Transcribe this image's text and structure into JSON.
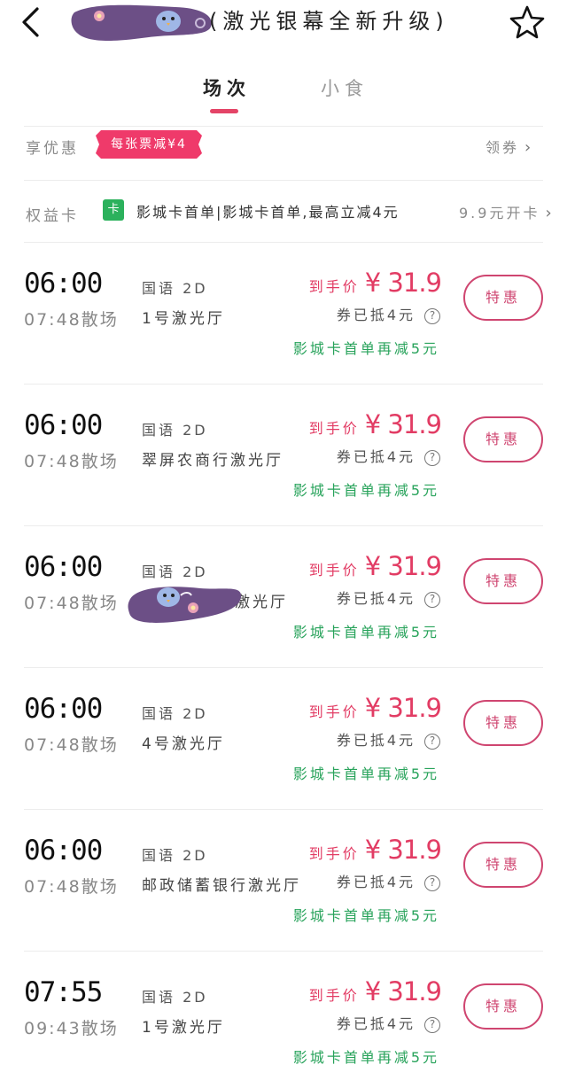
{
  "header": {
    "title": "(激光银幕全新升级)",
    "back_icon": "chevron-left-icon",
    "favorite_icon": "star-outline-icon"
  },
  "tabs": [
    {
      "label": "场次",
      "active": true
    },
    {
      "label": "小食",
      "active": false
    }
  ],
  "offers": {
    "label": "享优惠",
    "badge": "每张票减¥4",
    "coupon_link": "领券"
  },
  "membership": {
    "label": "权益卡",
    "icon_text": "卡",
    "description": "影城卡首单|影城卡首单,最高立减4元",
    "open_link": "9.9元开卡"
  },
  "colors": {
    "accent_pink": "#e44467",
    "price_red": "#e23c64",
    "card_green": "#28a35b",
    "badge_bg": "#ef3a6a"
  },
  "showtimes": [
    {
      "start": "06:00",
      "end": "07:48散场",
      "format": "国语 2D",
      "hall": "1号激光厅",
      "price_label": "到手价",
      "price": "¥ 31.9",
      "coupon": "券已抵4元",
      "card_discount": "影城卡首单再减5元",
      "button": "特惠"
    },
    {
      "start": "06:00",
      "end": "07:48散场",
      "format": "国语 2D",
      "hall": "翠屏农商行激光厅",
      "price_label": "到手价",
      "price": "¥ 31.9",
      "coupon": "券已抵4元",
      "card_discount": "影城卡首单再减5元",
      "button": "特惠"
    },
    {
      "start": "06:00",
      "end": "07:48散场",
      "format": "国语 2D",
      "hall": "激光厅",
      "price_label": "到手价",
      "price": "¥ 31.9",
      "coupon": "券已抵4元",
      "card_discount": "影城卡首单再减5元",
      "button": "特惠"
    },
    {
      "start": "06:00",
      "end": "07:48散场",
      "format": "国语 2D",
      "hall": "4号激光厅",
      "price_label": "到手价",
      "price": "¥ 31.9",
      "coupon": "券已抵4元",
      "card_discount": "影城卡首单再减5元",
      "button": "特惠"
    },
    {
      "start": "06:00",
      "end": "07:48散场",
      "format": "国语 2D",
      "hall": "邮政储蓄银行激光厅",
      "price_label": "到手价",
      "price": "¥ 31.9",
      "coupon": "券已抵4元",
      "card_discount": "影城卡首单再减5元",
      "button": "特惠"
    },
    {
      "start": "07:55",
      "end": "09:43散场",
      "format": "国语 2D",
      "hall": "1号激光厅",
      "price_label": "到手价",
      "price": "¥ 31.9",
      "coupon": "券已抵4元",
      "card_discount": "影城卡首单再减5元",
      "button": "特惠"
    }
  ]
}
